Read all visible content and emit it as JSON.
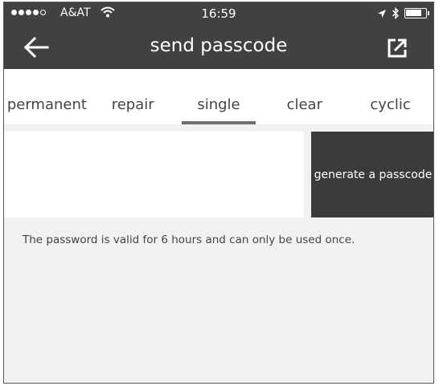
{
  "status_bar": {
    "carrier": "A&AT",
    "time": "16:59"
  },
  "header": {
    "title": "send passcode",
    "back_icon": "arrow-left-icon",
    "share_icon": "external-link-icon"
  },
  "tabs": [
    {
      "label": "permanent",
      "active": false
    },
    {
      "label": "repair",
      "active": false
    },
    {
      "label": "single",
      "active": true
    },
    {
      "label": "clear",
      "active": false
    },
    {
      "label": "cyclic",
      "active": false
    }
  ],
  "main": {
    "passcode_value": "",
    "generate_label": "generate a passcode",
    "hint": "The password is valid for 6 hours and can only be used once."
  },
  "colors": {
    "header_bg": "#414141",
    "button_bg": "#3b3b3b",
    "page_bg": "#f1f1f1"
  }
}
